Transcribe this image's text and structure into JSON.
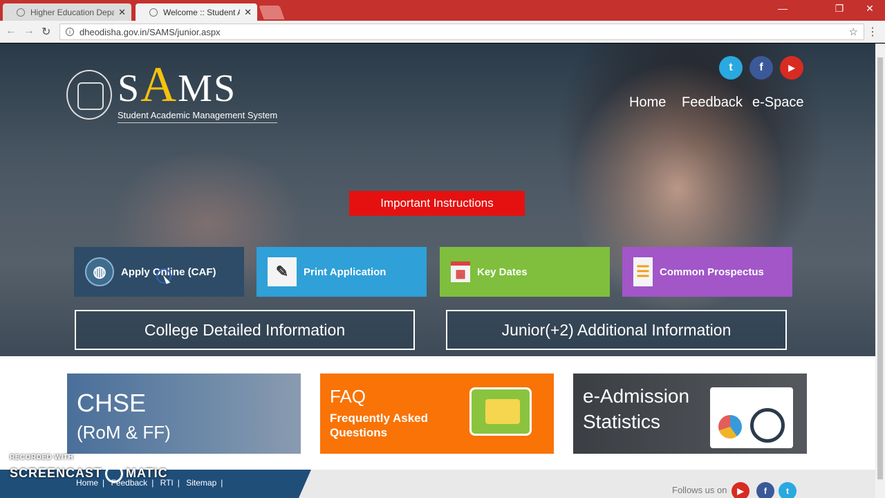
{
  "browser": {
    "tabs": [
      {
        "title": "Higher Education Depar",
        "active": false
      },
      {
        "title": "Welcome :: Student Acad",
        "active": true
      }
    ],
    "url": "dheodisha.gov.in/SAMS/junior.aspx",
    "tab_close": "✕",
    "win_min": "—",
    "win_restore": "❐",
    "win_close": "✕"
  },
  "header": {
    "brand_s": "S",
    "brand_a": "A",
    "brand_ms": "MS",
    "tagline": "Student Academic Management System",
    "social": {
      "twitter": "t",
      "facebook": "f",
      "youtube": "▶"
    },
    "nav": [
      "Home",
      "Feedback",
      "e-Space"
    ]
  },
  "hero": {
    "instructions_label": "Important Instructions",
    "tiles": [
      {
        "label": "Apply Online (CAF)",
        "icon": "globe-icon",
        "color": "#2e4c67"
      },
      {
        "label": "Print Application",
        "icon": "document-edit-icon",
        "color": "#2fa0d8"
      },
      {
        "label": "Key Dates",
        "icon": "calendar-icon",
        "color": "#7fbf3d"
      },
      {
        "label": "Common Prospectus",
        "icon": "document-icon",
        "color": "#a256c8"
      }
    ],
    "outline_buttons": [
      "College Detailed Information",
      "Junior(+2) Additional Information"
    ]
  },
  "cards": {
    "chse": {
      "title": "CHSE",
      "subtitle": "(RoM & FF)"
    },
    "faq": {
      "title": "FAQ",
      "subtitle": "Frequently Asked Questions"
    },
    "stats": {
      "title_line1": "e-Admission",
      "title_line2": "Statistics"
    }
  },
  "footer": {
    "links": [
      "Home",
      "Feedback",
      "RTI",
      "Sitemap"
    ],
    "follow": "Follows us on"
  },
  "watermark": {
    "line1": "RECORDED WITH",
    "line2a": "SCREENCAST",
    "line2b": "MATIC"
  },
  "colors": {
    "brand_accent": "#f6c20f",
    "instructions": "#e51111",
    "chrome": "#c5312d"
  }
}
